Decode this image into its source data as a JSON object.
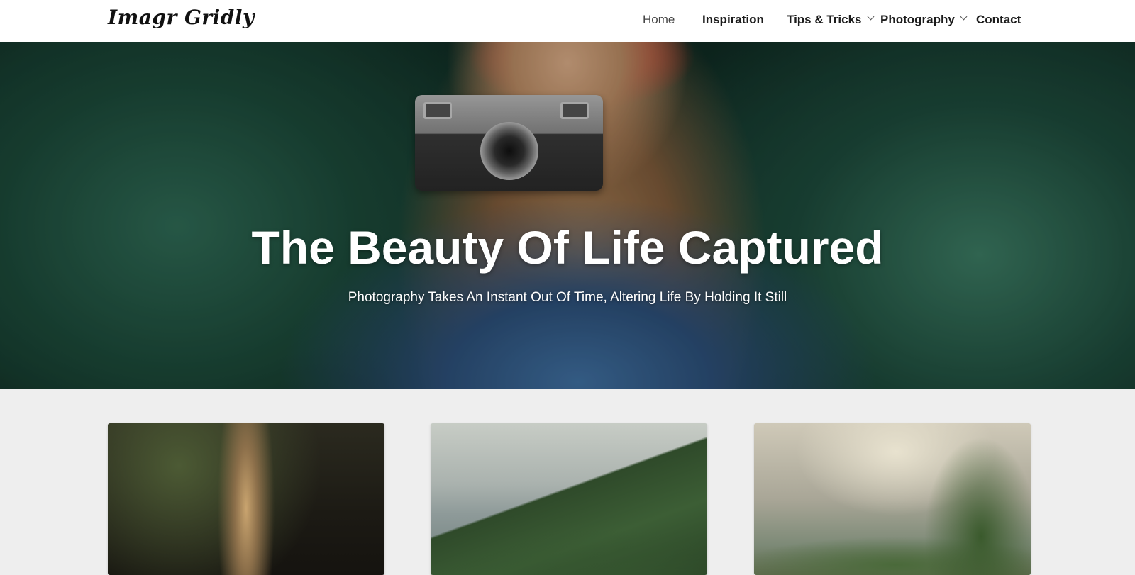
{
  "header": {
    "logo": "Imagr Gridly",
    "nav": [
      {
        "label": "Home",
        "has_dropdown": false,
        "active": true
      },
      {
        "label": "Inspiration",
        "has_dropdown": false
      },
      {
        "label": "Tips & Tricks",
        "has_dropdown": true
      },
      {
        "label": "Photography",
        "has_dropdown": true
      },
      {
        "label": "Contact",
        "has_dropdown": false
      }
    ]
  },
  "hero": {
    "title": "The Beauty Of Life Captured",
    "subtitle": "Photography Takes An Instant Out Of Time, Altering Life By Holding It Still"
  },
  "cards": [
    {
      "image": "forest-light-rays-photo"
    },
    {
      "image": "mountain-clouds-photo"
    },
    {
      "image": "lake-trees-landscape-photo"
    }
  ],
  "colors": {
    "header_bg": "#ffffff",
    "page_bg": "#eeeeee",
    "hero_text": "#ffffff",
    "nav_text": "#1c1c1c"
  }
}
